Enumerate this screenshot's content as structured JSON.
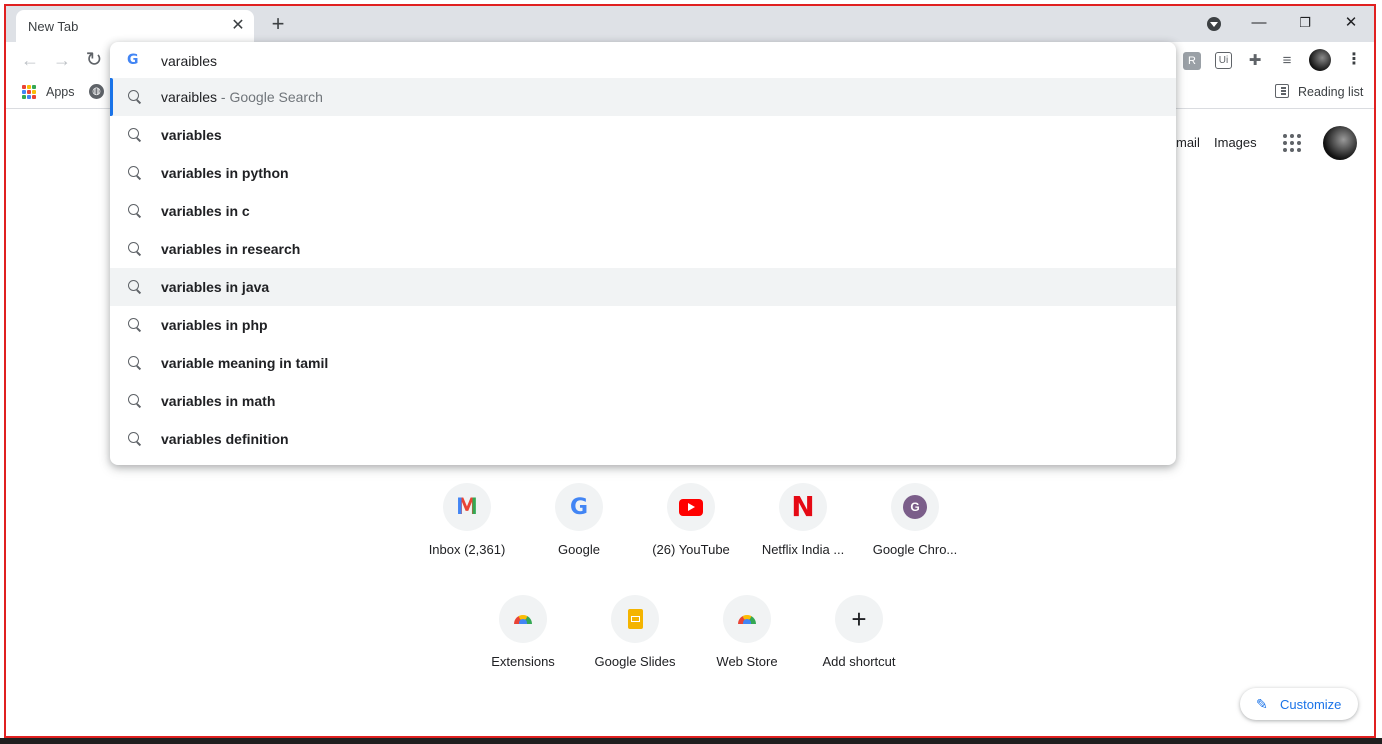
{
  "tab": {
    "title": "New Tab",
    "close": "✕",
    "new_tab": "+"
  },
  "window": {
    "minimize": "—",
    "restore": "❐",
    "close": "✕"
  },
  "toolbar": {
    "back": "←",
    "forward": "→",
    "reload": "↻",
    "menu": "⋮",
    "extensions": [
      "R",
      "Ui",
      "puzzle-icon",
      "media-icon"
    ]
  },
  "bookmarks": {
    "apps_label": "Apps",
    "reading_list": "Reading list"
  },
  "omnibox": {
    "query": "varaibles",
    "first": {
      "main": "varaibles",
      "sub": " - Google Search"
    },
    "suggestions": [
      "variables",
      "variables in python",
      "variables in c",
      "variables in research",
      "variables in java",
      "variables in php",
      "variable meaning in tamil",
      "variables in math",
      "variables definition"
    ]
  },
  "header_links": {
    "gmail": "mail",
    "images": "Images"
  },
  "shortcuts": [
    {
      "label": "Inbox (2,361)",
      "icon": "gmail-icon"
    },
    {
      "label": "Google",
      "icon": "google-icon"
    },
    {
      "label": "(26) YouTube",
      "icon": "youtube-icon"
    },
    {
      "label": "Netflix India ...",
      "icon": "netflix-icon"
    },
    {
      "label": "Google Chro...",
      "icon": "letter-g-icon"
    },
    {
      "label": "Extensions",
      "icon": "chrome-web-store-icon"
    },
    {
      "label": "Google Slides",
      "icon": "slides-icon"
    },
    {
      "label": "Web Store",
      "icon": "chrome-web-store-icon"
    },
    {
      "label": "Add shortcut",
      "icon": "plus-icon"
    }
  ],
  "customize": {
    "label": "Customize"
  },
  "colors": {
    "accent": "#1a73e8",
    "frame": "#e02020",
    "tabstrip": "#dee1e6"
  }
}
